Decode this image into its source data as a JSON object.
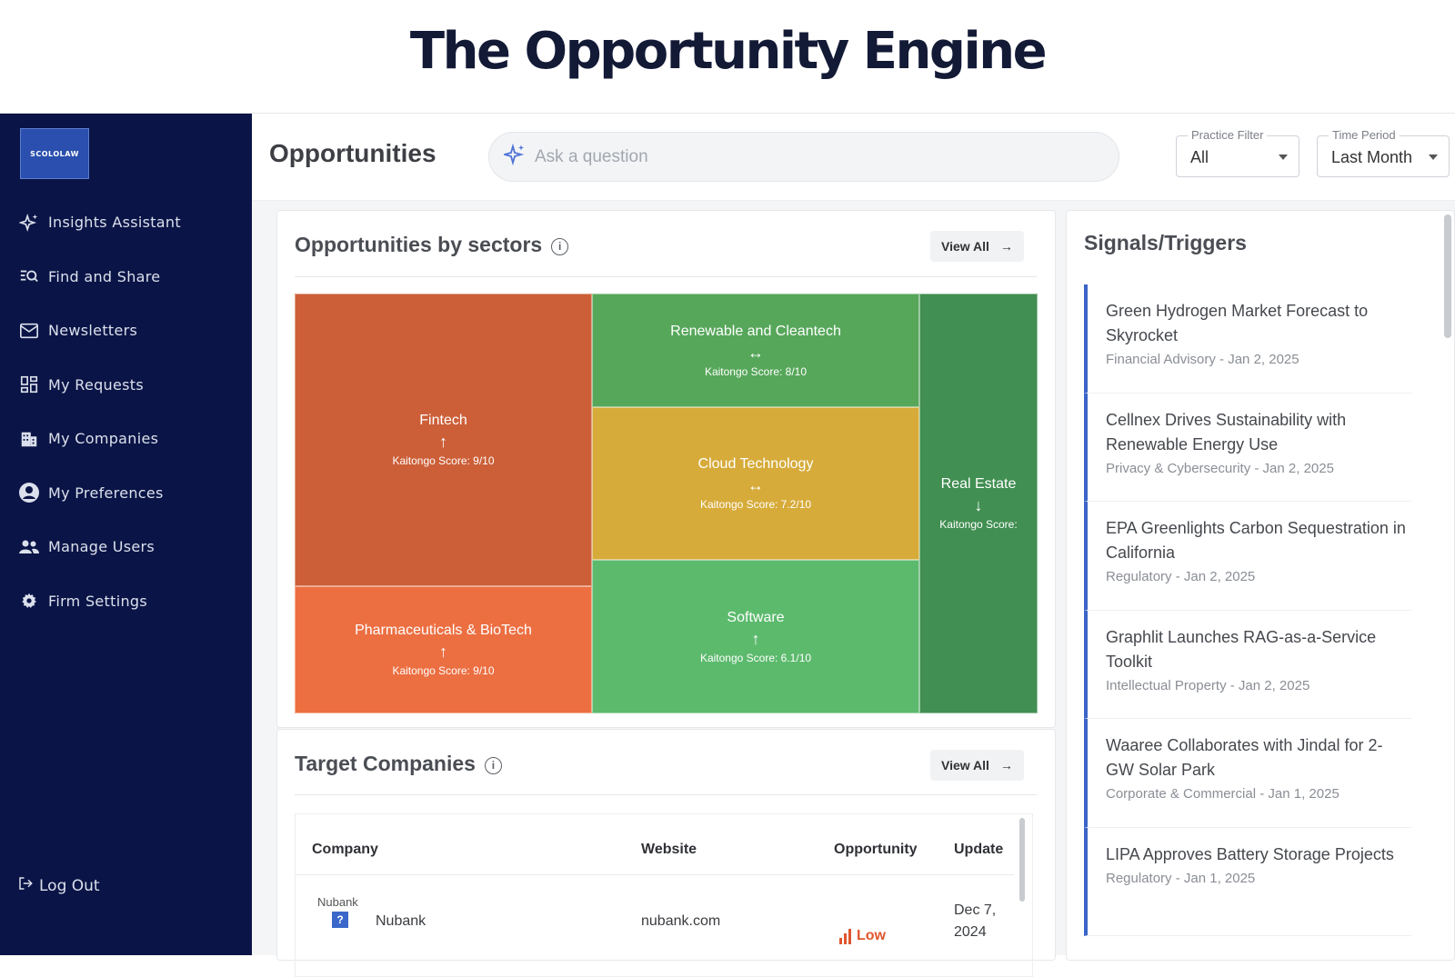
{
  "hero": {
    "title": "The Opportunity Engine"
  },
  "sidebar": {
    "logo_text": "SCOLOLAW",
    "items": [
      {
        "label": "Insights Assistant",
        "icon": "sparkle-icon"
      },
      {
        "label": "Find and Share",
        "icon": "list-search-icon"
      },
      {
        "label": "Newsletters",
        "icon": "mail-icon"
      },
      {
        "label": "My Requests",
        "icon": "grid-icon"
      },
      {
        "label": "My Companies",
        "icon": "building-icon"
      },
      {
        "label": "My Preferences",
        "icon": "user-circle-icon"
      },
      {
        "label": "Manage Users",
        "icon": "users-icon"
      },
      {
        "label": "Firm Settings",
        "icon": "gear-icon"
      }
    ],
    "logout_label": "Log Out"
  },
  "topbar": {
    "title": "Opportunities",
    "search_placeholder": "Ask a question",
    "practice_filter": {
      "label": "Practice Filter",
      "value": "All"
    },
    "time_period": {
      "label": "Time Period",
      "value": "Last Month"
    }
  },
  "sectors": {
    "title": "Opportunities by sectors",
    "view_all": "View All",
    "arrow": "→",
    "tiles": [
      {
        "name": "Fintech",
        "arrow": "↑",
        "score": "Kaitongo Score: 9/10",
        "color": "#cc5f38"
      },
      {
        "name": "Pharmaceuticals & BioTech",
        "arrow": "↑",
        "score": "Kaitongo Score: 9/10",
        "color": "#ec6f42"
      },
      {
        "name": "Renewable and Cleantech",
        "arrow": "↔",
        "score": "Kaitongo Score: 8/10",
        "color": "#56a75a"
      },
      {
        "name": "Cloud Technology",
        "arrow": "↔",
        "score": "Kaitongo Score: 7.2/10",
        "color": "#d6ab3a"
      },
      {
        "name": "Software",
        "arrow": "↑",
        "score": "Kaitongo Score: 6.1/10",
        "color": "#5cba6d"
      },
      {
        "name": "Real Estate",
        "arrow": "↓",
        "score": "Kaitongo Score:",
        "color": "#418f52"
      }
    ]
  },
  "targets": {
    "title": "Target Companies",
    "view_all": "View All",
    "arrow": "→",
    "headers": [
      "Company",
      "Website",
      "Opportunity",
      "Update"
    ],
    "rows": [
      {
        "logo_text": "Nubank",
        "company": "Nubank",
        "website": "nubank.com",
        "opportunity": "Low",
        "update_line1": "Dec 7,",
        "update_line2": "2024"
      }
    ]
  },
  "signals": {
    "title": "Signals/Triggers",
    "accent": "#3b64c8",
    "items": [
      {
        "title": "Green Hydrogen Market Forecast to Skyrocket",
        "meta": "Financial Advisory - Jan 2, 2025"
      },
      {
        "title": "Cellnex Drives Sustainability with Renewable Energy Use",
        "meta": "Privacy & Cybersecurity - Jan 2, 2025"
      },
      {
        "title": "EPA Greenlights Carbon Sequestration in California",
        "meta": "Regulatory - Jan 2, 2025"
      },
      {
        "title": "Graphlit Launches RAG-as-a-Service Toolkit",
        "meta": "Intellectual Property - Jan 2, 2025"
      },
      {
        "title": "Waaree Collaborates with Jindal for 2-GW Solar Park",
        "meta": "Corporate & Commercial - Jan 1, 2025"
      },
      {
        "title": "LIPA Approves Battery Storage Projects",
        "meta": "Regulatory - Jan 1, 2025"
      }
    ]
  }
}
